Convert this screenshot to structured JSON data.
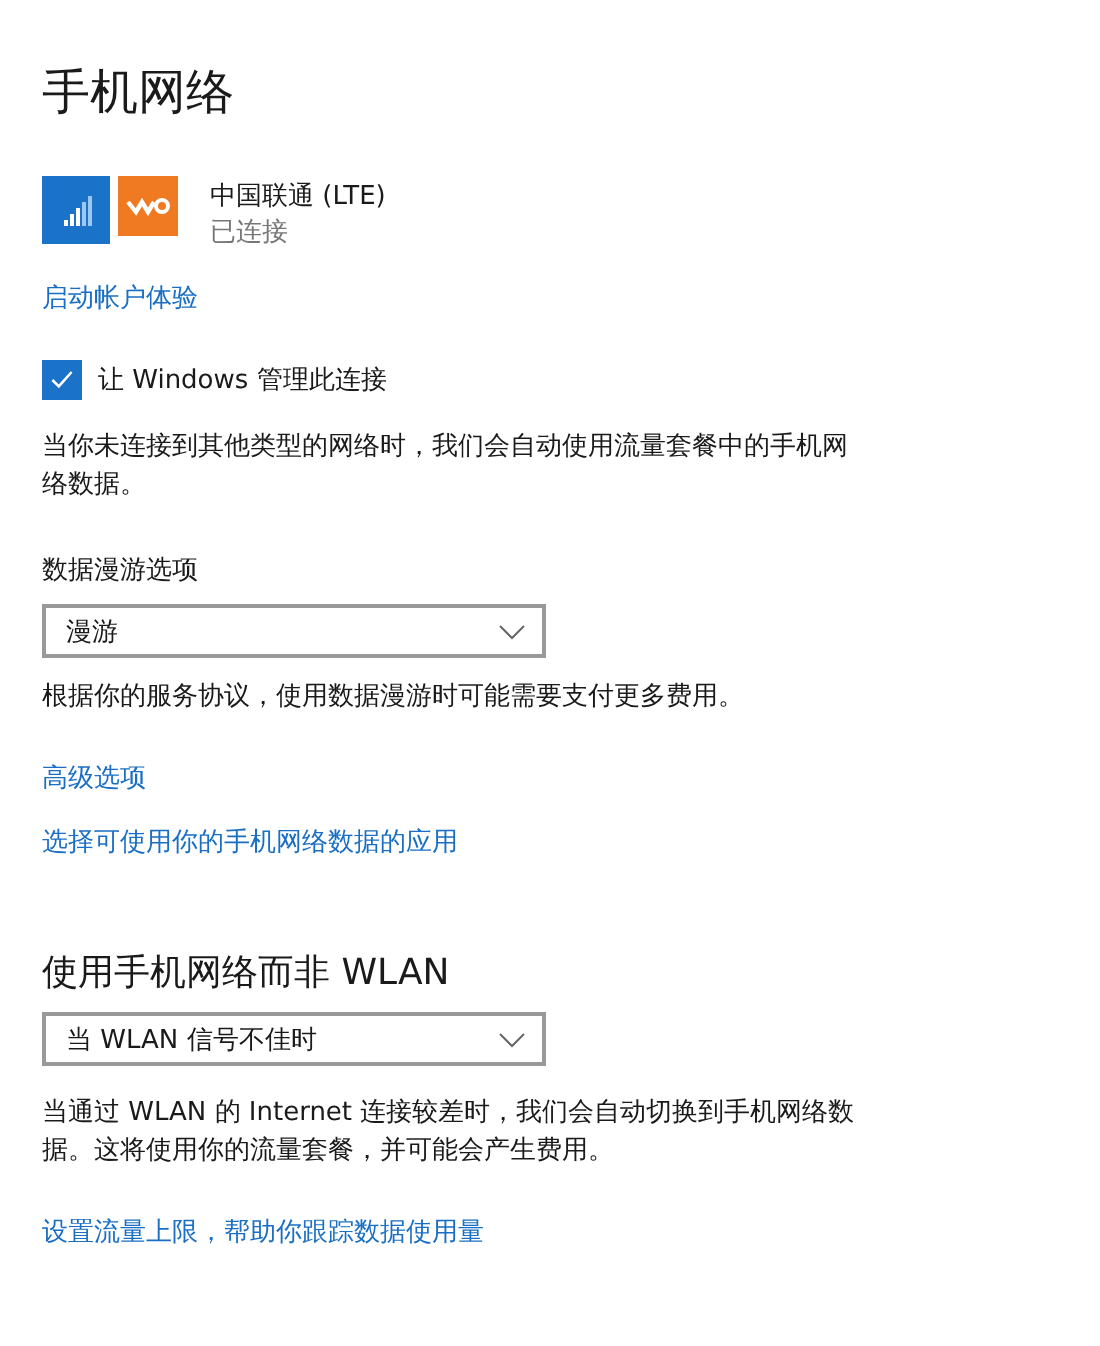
{
  "title": "手机网络",
  "carrier": {
    "name": "中国联通 (LTE)",
    "status": "已连接"
  },
  "account_link": "启动帐户体验",
  "manage_checkbox": {
    "label": "让 Windows 管理此连接",
    "checked": true
  },
  "auto_note": "当你未连接到其他类型的网络时，我们会自动使用流量套餐中的手机网络数据。",
  "roaming": {
    "label": "数据漫游选项",
    "value": "漫游",
    "note": "根据你的服务协议，使用数据漫游时可能需要支付更多费用。"
  },
  "links": [
    "高级选项",
    "选择可使用你的手机网络数据的应用"
  ],
  "wlan_section": {
    "heading": "使用手机网络而非 WLAN",
    "value": "当 WLAN 信号不佳时",
    "note": "当通过 WLAN 的 Internet 连接较差时，我们会自动切换到手机网络数据。这将使用你的流量套餐，并可能会产生费用。"
  },
  "limit_link": "设置流量上限，帮助你跟踪数据使用量"
}
